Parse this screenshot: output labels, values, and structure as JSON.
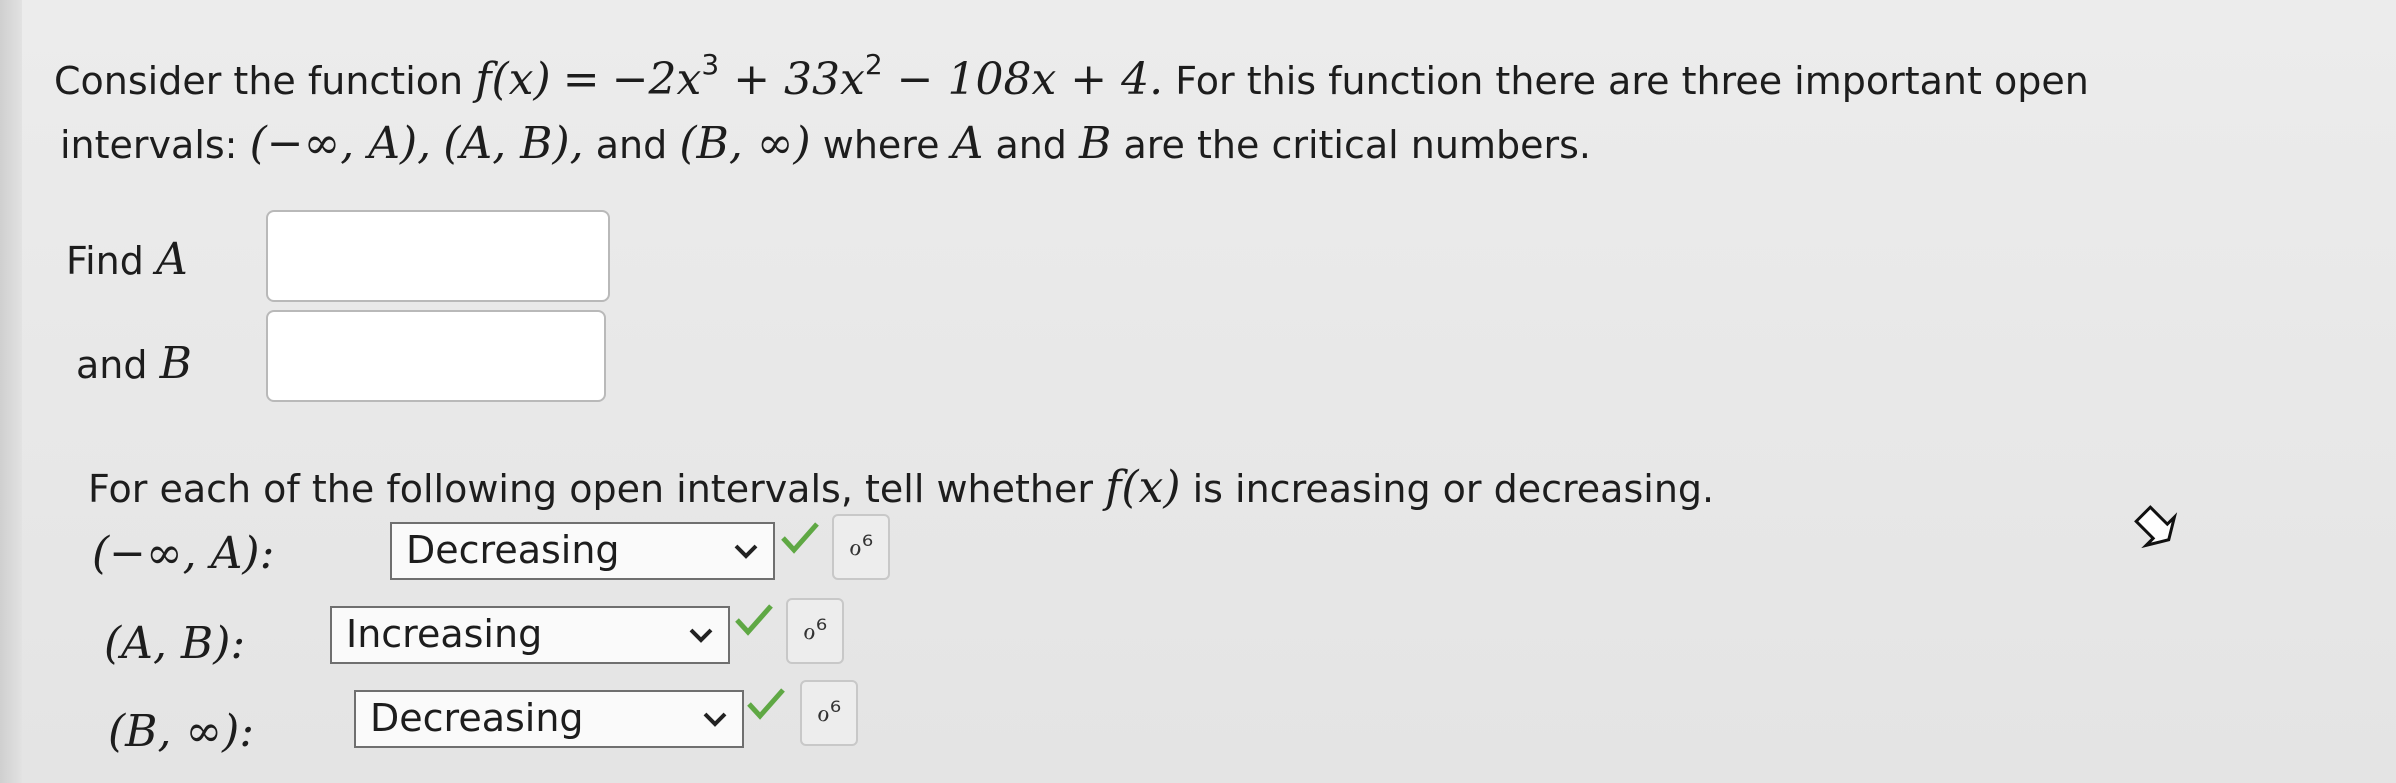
{
  "question": {
    "intro_prefix": "Consider the function",
    "function_lhs": "f(x)",
    "function_equals": "=",
    "function_rhs_term1": "−2x",
    "function_rhs_exp1": "3",
    "function_rhs_term2": " + 33x",
    "function_rhs_exp2": "2",
    "function_rhs_term3": " − 108x + 4.",
    "intro_suffix": "For this function there are three important open",
    "intervals_label": "intervals:",
    "interval1": "(−∞, A),",
    "interval2": "(A, B),",
    "and_word": "and",
    "interval3": "(B, ∞)",
    "where_text": "where",
    "var_a": "A",
    "and_text": "and",
    "var_b": "B",
    "critical_text": "are the critical numbers."
  },
  "find_a": {
    "label_prefix": "Find",
    "label_var": "A",
    "value": ""
  },
  "find_b": {
    "label_prefix": "and",
    "label_var": "B",
    "value": ""
  },
  "instruction": {
    "prefix": "For each of the following open intervals, tell whether",
    "func": "f(x)",
    "suffix": "is increasing or decreasing."
  },
  "rows": [
    {
      "interval": "(−∞, A):",
      "selected": "Decreasing",
      "status": "correct",
      "key_icon": "ℴ⁶"
    },
    {
      "interval": "(A, B):",
      "selected": "Increasing",
      "status": "correct",
      "key_icon": "ℴ⁶"
    },
    {
      "interval": "(B, ∞):",
      "selected": "Decreasing",
      "status": "correct",
      "key_icon": "ℴ⁶"
    }
  ],
  "colors": {
    "check": "#5fa844",
    "text": "#1d1d1d",
    "box_border": "#b9b9b9"
  }
}
